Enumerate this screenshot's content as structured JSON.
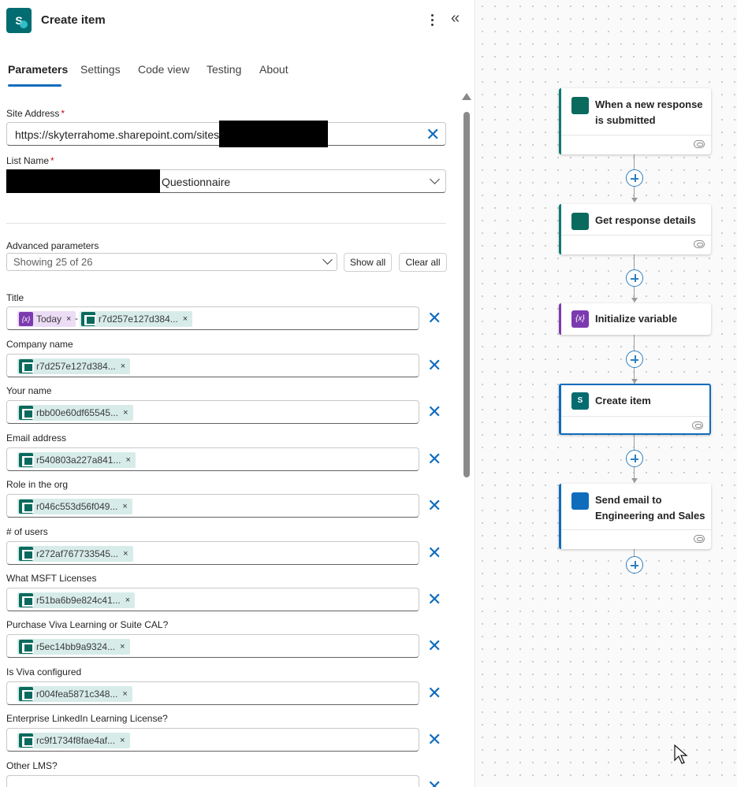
{
  "panel": {
    "title": "Create item",
    "app_icon_letter": "S",
    "tabs": [
      "Parameters",
      "Settings",
      "Code view",
      "Testing",
      "About"
    ]
  },
  "site_address": {
    "label": "Site Address",
    "required_mark": "*",
    "value": "https://skyterrahome.sharepoint.com/sites/"
  },
  "list_name": {
    "label": "List Name",
    "required_mark": "*",
    "value": "Questionnaire"
  },
  "advanced": {
    "label": "Advanced parameters",
    "selected": "Showing 25 of 26",
    "show_all": "Show all",
    "clear_all": "Clear all"
  },
  "fields": [
    {
      "label": "Title",
      "tokens": [
        "Today",
        "r7d257e127d384..."
      ],
      "separator": "-"
    },
    {
      "label": "Company name",
      "tokens": [
        "r7d257e127d384..."
      ]
    },
    {
      "label": "Your name",
      "tokens": [
        "rbb00e60df65545..."
      ]
    },
    {
      "label": "Email address",
      "tokens": [
        "r540803a227a841..."
      ]
    },
    {
      "label": "Role in the org",
      "tokens": [
        "r046c553d56f049..."
      ]
    },
    {
      "label": "# of users",
      "tokens": [
        "r272af767733545..."
      ]
    },
    {
      "label": "What MSFT Licenses",
      "tokens": [
        "r51ba6b9e824c41..."
      ]
    },
    {
      "label": "Purchase Viva Learning or Suite CAL?",
      "tokens": [
        "r5ec14bb9a9324..."
      ]
    },
    {
      "label": "Is Viva configured",
      "tokens": [
        "r004fea5871c348..."
      ]
    },
    {
      "label": "Enterprise LinkedIn Learning License?",
      "tokens": [
        "rc9f1734f8fae4af..."
      ]
    },
    {
      "label": "Other LMS?",
      "tokens": []
    }
  ],
  "flow": {
    "steps": [
      {
        "title": "When a new response is submitted",
        "icon": "forms-icon"
      },
      {
        "title": "Get response details",
        "icon": "forms-icon"
      },
      {
        "title": "Initialize variable",
        "icon": "variable-icon"
      },
      {
        "title": "Create item",
        "icon": "sharepoint-icon"
      },
      {
        "title": "Send email to Engineering and Sales",
        "icon": "outlook-icon"
      }
    ]
  },
  "colors": {
    "accent": "#0f6cbd",
    "sharepoint": "#036c70",
    "forms": "#0b6a5e",
    "variable": "#7c3aaf",
    "outlook": "#0f6cbd"
  }
}
